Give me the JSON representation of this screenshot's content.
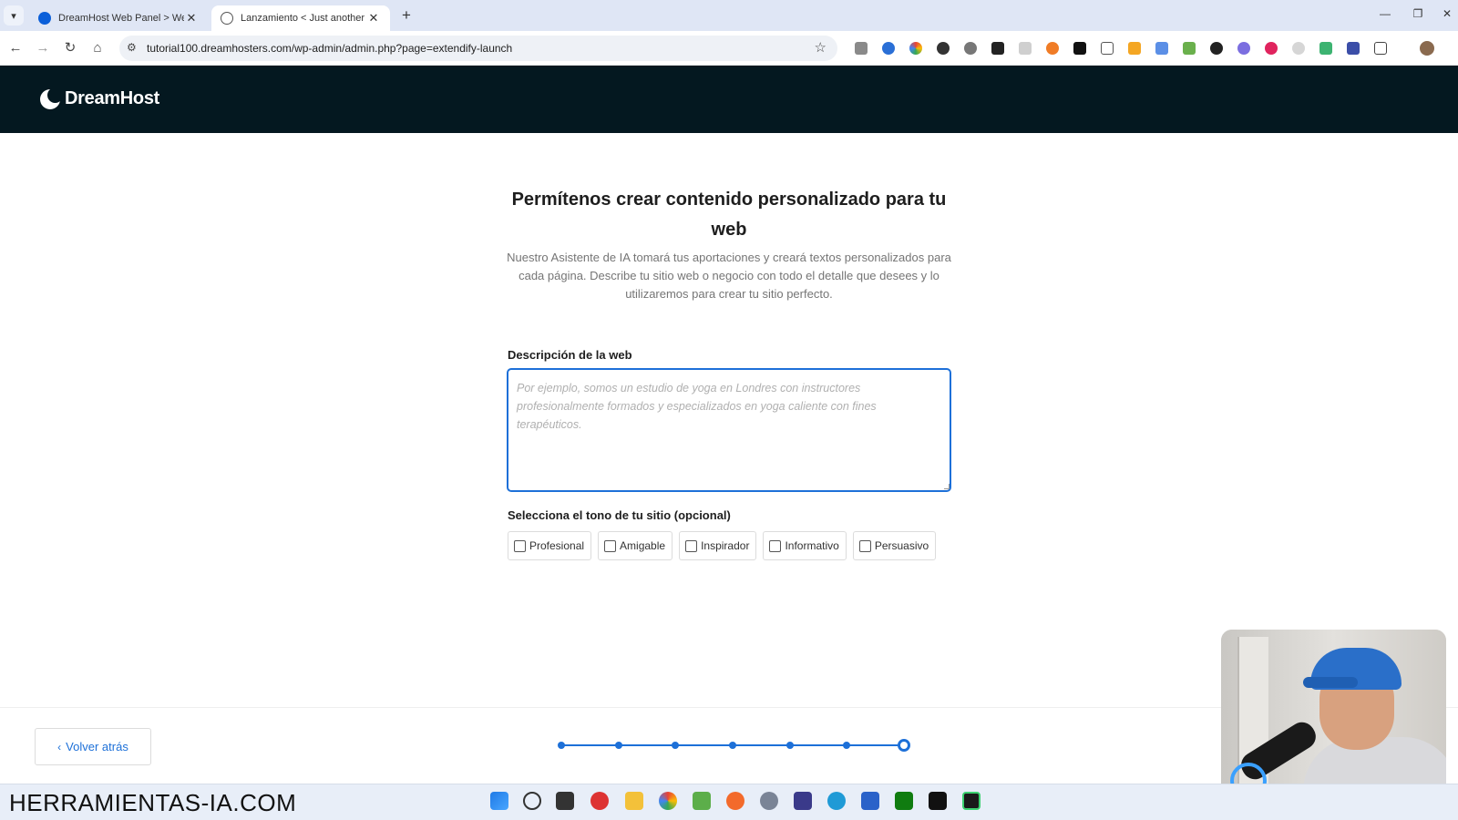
{
  "browser": {
    "tabs": [
      {
        "title": "DreamHost Web Panel > Webs",
        "active": false
      },
      {
        "title": "Lanzamiento < Just another W",
        "active": true
      }
    ],
    "tab_close": "✕",
    "new_tab": "+",
    "url": "tutorial100.dreamhosters.com/wp-admin/admin.php?page=extendify-launch"
  },
  "brand": {
    "logo_text": "DreamHost"
  },
  "main": {
    "title": "Permítenos crear contenido personalizado para tu web",
    "subtitle": "Nuestro Asistente de IA tomará tus aportaciones y creará textos personalizados para cada página. Describe tu sitio web o negocio con todo el detalle que desees y lo utilizaremos para crear tu sitio perfecto.",
    "description_label": "Descripción de la web",
    "description_placeholder": "Por ejemplo, somos un estudio de yoga en Londres con instructores profesionalmente formados y especializados en yoga caliente con fines terapéuticos.",
    "description_value": "",
    "tone_label": "Selecciona el tono de tu sitio (opcional)",
    "tones": [
      {
        "label": "Profesional",
        "checked": false
      },
      {
        "label": "Amigable",
        "checked": false
      },
      {
        "label": "Inspirador",
        "checked": false
      },
      {
        "label": "Informativo",
        "checked": false
      },
      {
        "label": "Persuasivo",
        "checked": false
      }
    ]
  },
  "footer": {
    "back_label": "Volver atrás",
    "progress": {
      "total_steps": 7,
      "current_step": 7
    }
  },
  "overlay": {
    "watermark": "HERRAMIENTAS-IA.COM"
  },
  "colors": {
    "accent": "#1d70d8",
    "header_bg": "#041820"
  }
}
